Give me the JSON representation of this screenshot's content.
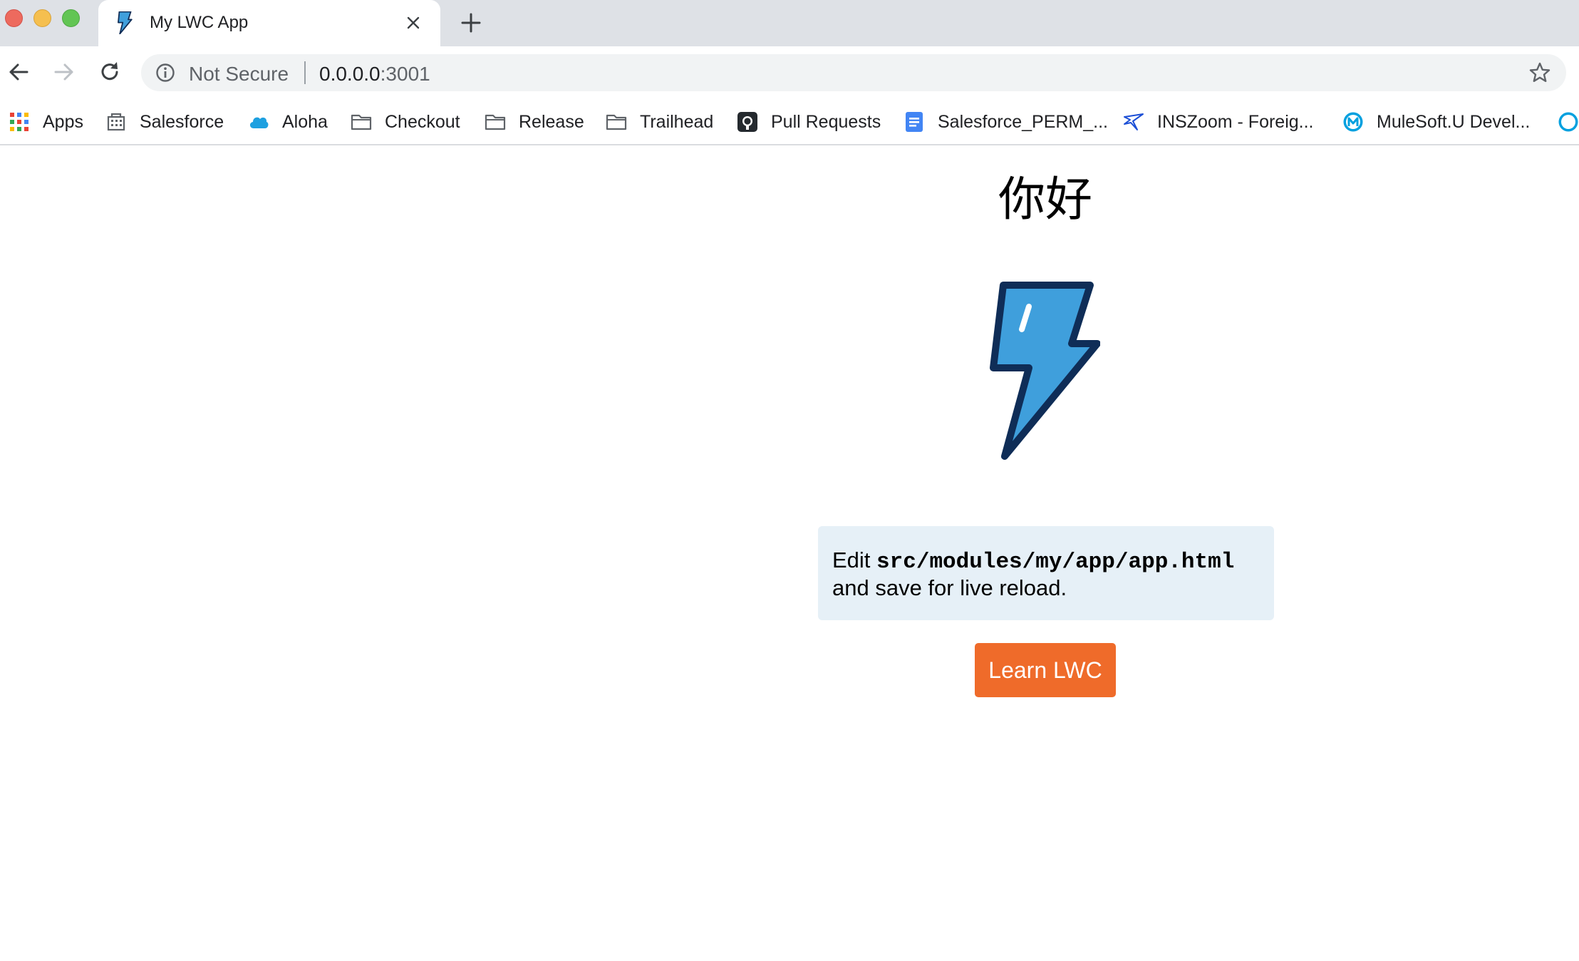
{
  "browser": {
    "tab": {
      "title": "My LWC App",
      "close_icon": "close-icon",
      "favicon": "lightning-bolt-icon"
    },
    "new_tab_icon": "plus-icon",
    "toolbar": {
      "back_icon": "arrow-left-icon",
      "forward_icon": "arrow-right-icon",
      "reload_icon": "reload-icon",
      "security_label": "Not Secure",
      "url_host": "0.0.0.0",
      "url_port": ":3001",
      "star_icon": "star-icon"
    },
    "bookmarks": [
      {
        "label": "Apps",
        "icon": "apps-grid-icon"
      },
      {
        "label": "Salesforce",
        "icon": "building-icon"
      },
      {
        "label": "Aloha",
        "icon": "cloud-icon"
      },
      {
        "label": "Checkout",
        "icon": "folder-icon"
      },
      {
        "label": "Release",
        "icon": "folder-icon"
      },
      {
        "label": "Trailhead",
        "icon": "folder-icon"
      },
      {
        "label": "Pull Requests",
        "icon": "github-icon"
      },
      {
        "label": "Salesforce_PERM_...",
        "icon": "google-doc-icon"
      },
      {
        "label": "INSZoom - Foreig...",
        "icon": "bird-icon"
      },
      {
        "label": "MuleSoft.U Devel...",
        "icon": "mulesoft-icon"
      }
    ]
  },
  "page": {
    "greeting": "你好",
    "logo_icon": "lightning-bolt-icon",
    "instructions": {
      "prefix": "Edit ",
      "path": "src/modules/my/app/app.html",
      "suffix": "and save for live reload."
    },
    "learn_button": "Learn LWC"
  },
  "colors": {
    "tab_strip": "#dee1e6",
    "omnibox": "#f1f3f4",
    "info_box": "#e6f0f7",
    "learn_button": "#ef6b2a",
    "bolt_fill": "#3f9fdc",
    "bolt_stroke": "#0f2d57"
  }
}
